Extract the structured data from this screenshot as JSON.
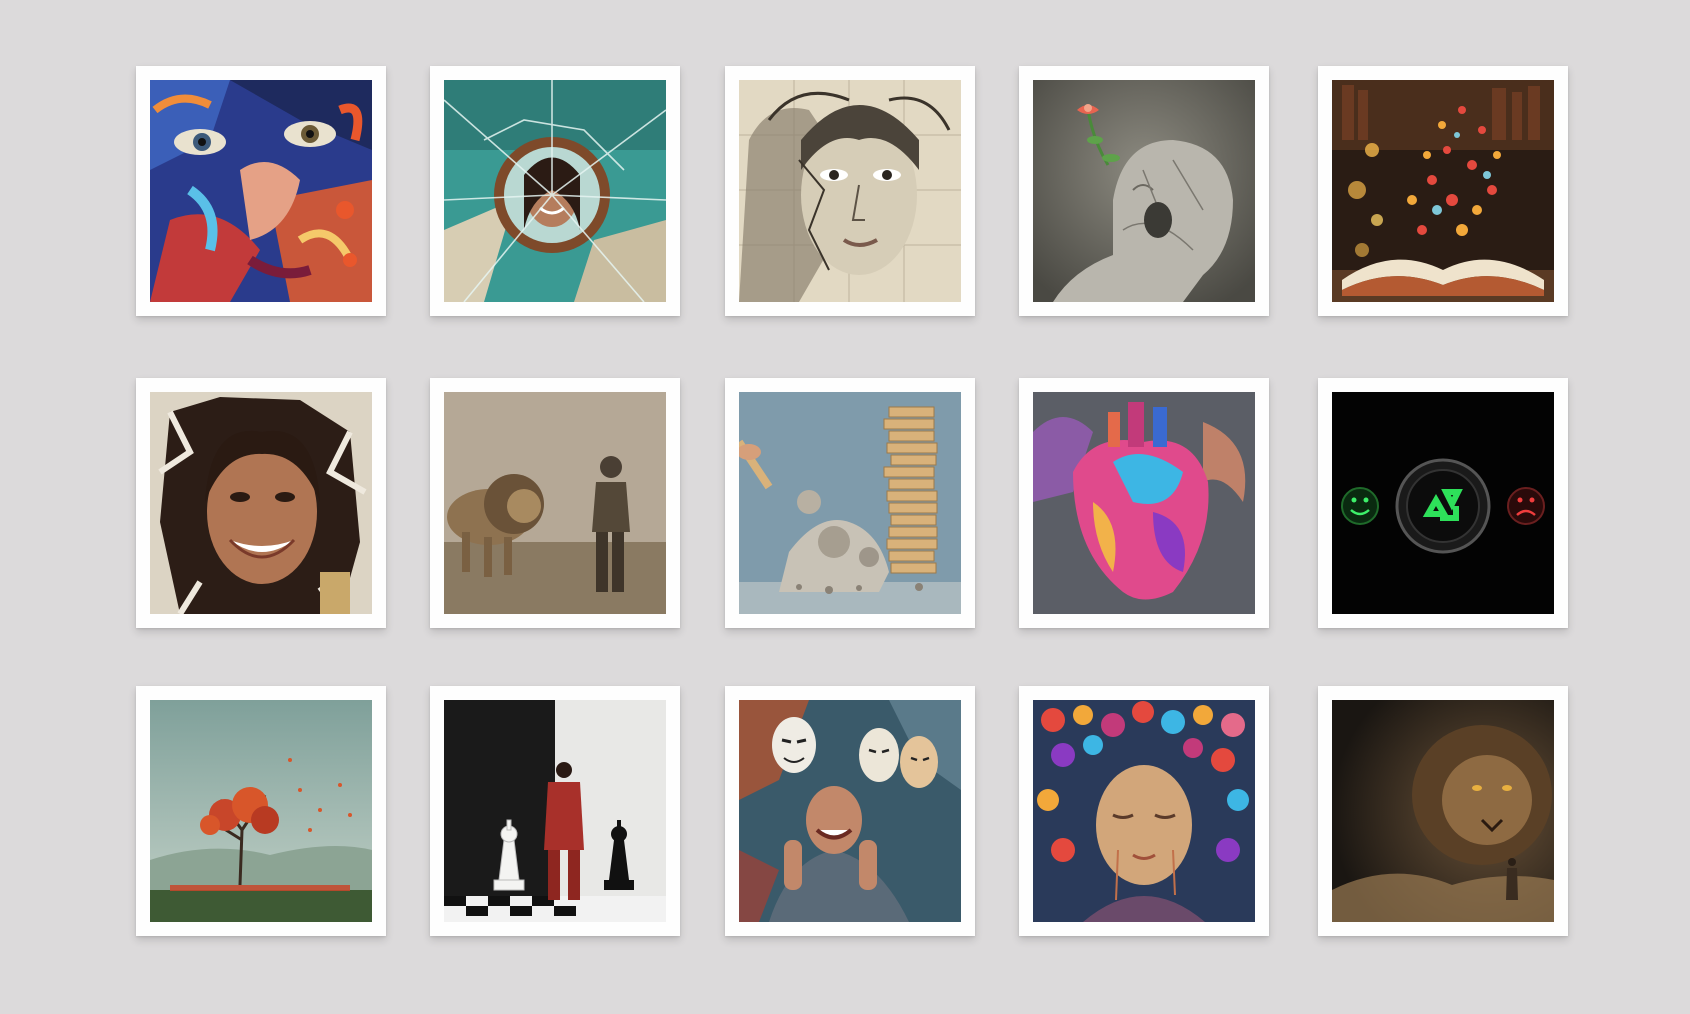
{
  "gallery": {
    "rows": 3,
    "columns": 5,
    "background_color": "#dcdadb",
    "frame_color": "#fefefe",
    "items": [
      {
        "subject": "abstract-painted-face"
      },
      {
        "subject": "woman-in-broken-mirror"
      },
      {
        "subject": "sketch-face-with-map"
      },
      {
        "subject": "stone-head-with-flower"
      },
      {
        "subject": "book-with-floating-hearts"
      },
      {
        "subject": "woman-smiling-through-wall"
      },
      {
        "subject": "lion-and-man-in-fog"
      },
      {
        "subject": "jenga-tower-crumbling"
      },
      {
        "subject": "painted-anatomical-heart"
      },
      {
        "subject": "emotion-buttons-recycle"
      },
      {
        "subject": "lone-tree-falling-leaves"
      },
      {
        "subject": "man-between-chess-kings"
      },
      {
        "subject": "man-with-masks"
      },
      {
        "subject": "girl-with-heart-hair"
      },
      {
        "subject": "lion-and-small-figure"
      }
    ]
  }
}
